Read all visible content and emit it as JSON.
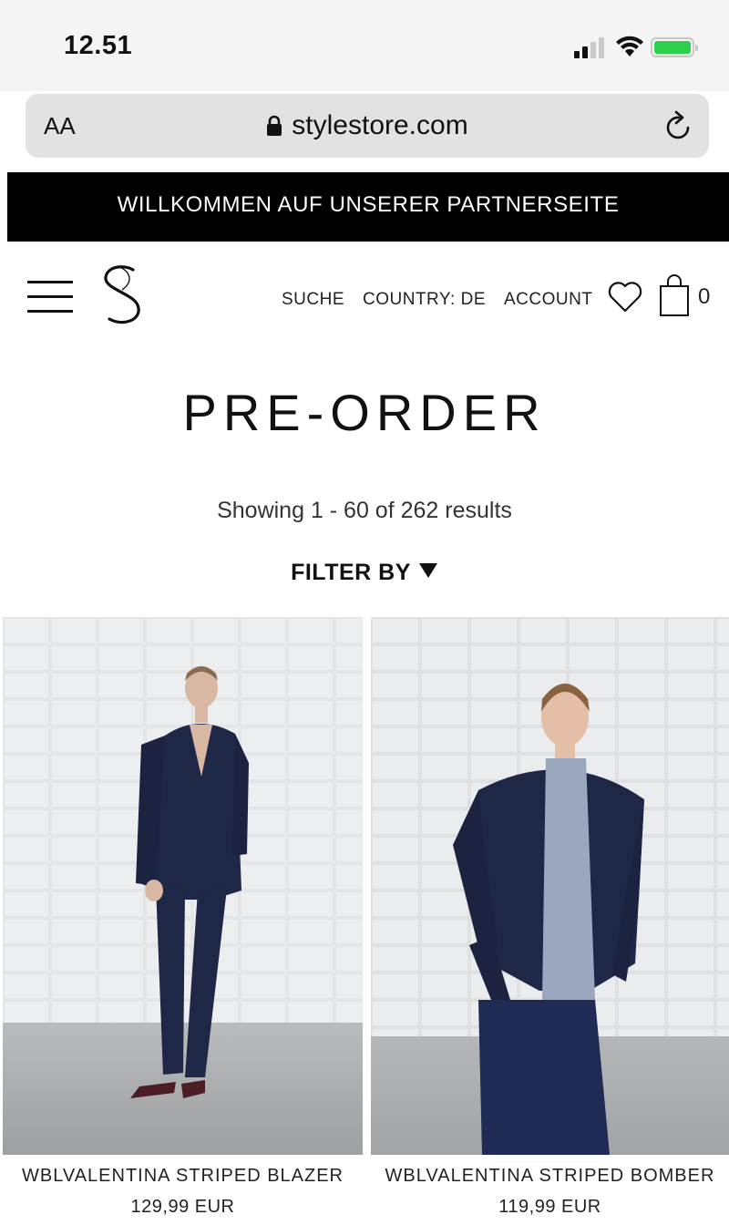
{
  "status_bar": {
    "time": "12.51",
    "battery_color": "#2bd14a"
  },
  "browser": {
    "text_size_label": "AA",
    "url": "stylestore.com",
    "icons": [
      "lock-icon",
      "reload-icon"
    ]
  },
  "banner": {
    "text": "WILLKOMMEN AUF UNSERER PARTNERSEITE"
  },
  "header": {
    "logo_letter": "S",
    "nav": {
      "search": "SUCHE",
      "country": "COUNTRY: DE",
      "account": "ACCOUNT"
    },
    "cart_count": "0",
    "icons": [
      "menu-icon",
      "heart-icon",
      "shopping-bag-icon"
    ]
  },
  "page": {
    "title": "PRE-ORDER",
    "results_text": "Showing 1 - 60 of 262 results",
    "filter_label": "FILTER BY"
  },
  "products": [
    {
      "name": "WBLVALENTINA STRIPED BLAZER",
      "price": "129,99 EUR"
    },
    {
      "name": "WBLVALENTINA STRIPED BOMBER",
      "price": "119,99 EUR"
    }
  ],
  "colors": {
    "banner_bg": "#000000",
    "garment_navy": "#1e2746",
    "shirt_blue": "#9aa7bf"
  }
}
